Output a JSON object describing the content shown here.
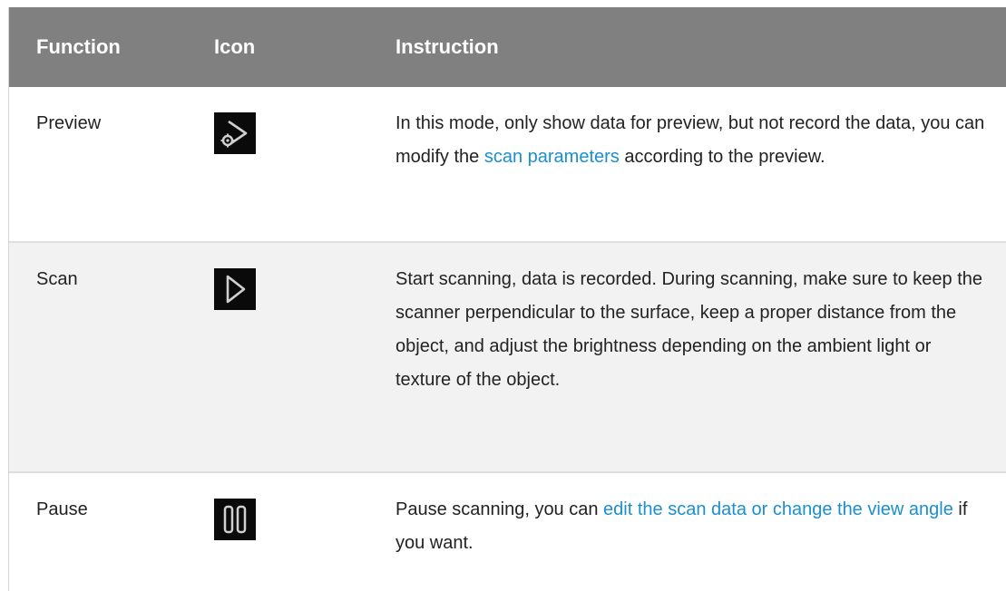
{
  "header": {
    "function": "Function",
    "icon": "Icon",
    "instruction": "Instruction"
  },
  "rows": [
    {
      "function": "Preview",
      "icon": "preview-icon",
      "instruction": {
        "before": "In this mode, only show data for preview, but not record the data, you can modify the ",
        "link": "scan parameters",
        "after": " according to the preview."
      }
    },
    {
      "function": "Scan",
      "icon": "play-icon",
      "instruction": {
        "text": "Start scanning, data is recorded. During scanning, make sure to keep the scanner perpendicular to the surface, keep a proper distance from the object, and adjust the brightness depending on the ambient light or texture of the object."
      }
    },
    {
      "function": "Pause",
      "icon": "pause-icon",
      "instruction": {
        "before": "Pause scanning, you can ",
        "link": "edit the scan data or change the view angle",
        "after": " if you want."
      }
    }
  ],
  "colors": {
    "header_bg": "#808080",
    "link": "#1a8fd1",
    "shaded_row": "#f2f2f2"
  }
}
